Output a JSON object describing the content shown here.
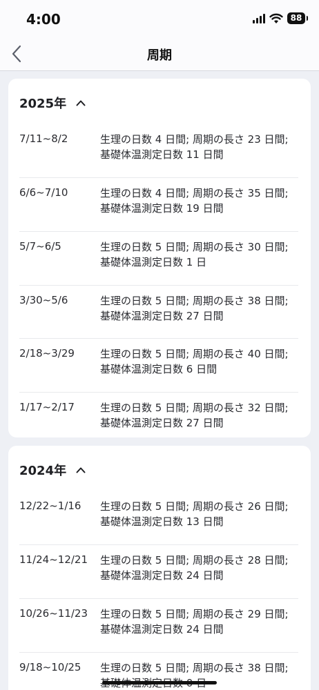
{
  "status_bar": {
    "time": "4:00",
    "battery": "88"
  },
  "nav": {
    "title": "周期"
  },
  "years": [
    {
      "label": "2025年",
      "cycles": [
        {
          "range": "7/11~8/2",
          "detail": "生理の日数 4 日間; 周期の長さ 23 日間; 基礎体温測定日数 11 日間"
        },
        {
          "range": "6/6~7/10",
          "detail": "生理の日数 4 日間; 周期の長さ 35 日間; 基礎体温測定日数 19 日間"
        },
        {
          "range": "5/7~6/5",
          "detail": "生理の日数 5 日間; 周期の長さ 30 日間; 基礎体温測定日数 1 日"
        },
        {
          "range": "3/30~5/6",
          "detail": "生理の日数 5 日間; 周期の長さ 38 日間; 基礎体温測定日数 27 日間"
        },
        {
          "range": "2/18~3/29",
          "detail": "生理の日数 5 日間; 周期の長さ 40 日間; 基礎体温測定日数 6 日間"
        },
        {
          "range": "1/17~2/17",
          "detail": "生理の日数 5 日間; 周期の長さ 32 日間; 基礎体温測定日数 27 日間"
        }
      ]
    },
    {
      "label": "2024年",
      "cycles": [
        {
          "range": "12/22~1/16",
          "detail": "生理の日数 5 日間; 周期の長さ 26 日間; 基礎体温測定日数 13 日間"
        },
        {
          "range": "11/24~12/21",
          "detail": "生理の日数 5 日間; 周期の長さ 28 日間; 基礎体温測定日数 24 日間"
        },
        {
          "range": "10/26~11/23",
          "detail": "生理の日数 5 日間; 周期の長さ 29 日間; 基礎体温測定日数 24 日間"
        },
        {
          "range": "9/18~10/25",
          "detail": "生理の日数 5 日間; 周期の長さ 38 日間; 基礎体温測定日数 0 日"
        }
      ]
    }
  ]
}
